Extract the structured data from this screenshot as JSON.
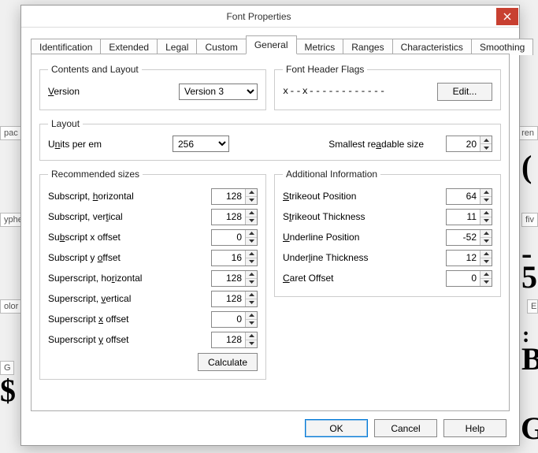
{
  "window": {
    "title": "Font Properties"
  },
  "tabs": {
    "identification": "Identification",
    "extended": "Extended",
    "legal": "Legal",
    "custom": "Custom",
    "general": "General",
    "metrics": "Metrics",
    "ranges": "Ranges",
    "characteristics": "Characteristics",
    "smoothing": "Smoothing"
  },
  "groups": {
    "contents": "Contents and Layout",
    "layout": "Layout",
    "recommended": "Recommended sizes",
    "flags": "Font Header Flags",
    "additional": "Additional Information"
  },
  "contents": {
    "version_label": "Version",
    "version_value": "Version 3"
  },
  "layout": {
    "units_label": "Units per em",
    "units_value": "256",
    "smallest_label": "Smallest readable size",
    "smallest_value": "20"
  },
  "recommended": {
    "sub_h_label": "Subscript, horizontal",
    "sub_h": "128",
    "sub_v_label": "Subscript, vertical",
    "sub_v": "128",
    "sub_x_label": "Subscript x offset",
    "sub_x": "0",
    "sub_y_label": "Subscript y offset",
    "sub_y": "16",
    "sup_h_label": "Superscript, horizontal",
    "sup_h": "128",
    "sup_v_label": "Superscript, vertical",
    "sup_v": "128",
    "sup_x_label": "Superscript x offset",
    "sup_x": "0",
    "sup_y_label": "Superscript y offset",
    "sup_y": "128",
    "calculate": "Calculate"
  },
  "flags": {
    "pattern": "x--x------------",
    "edit": "Edit..."
  },
  "additional": {
    "strike_pos_label": "Strikeout Position",
    "strike_pos": "64",
    "strike_thk_label": "Strikeout Thickness",
    "strike_thk": "11",
    "under_pos_label": "Underline Position",
    "under_pos": "-52",
    "under_thk_label": "Underline Thickness",
    "under_thk": "12",
    "caret_label": "Caret Offset",
    "caret": "0"
  },
  "buttons": {
    "ok": "OK",
    "cancel": "Cancel",
    "help": "Help"
  },
  "bg": {
    "pac": "pac",
    "yphe": "yphe",
    "olor": "olor",
    "g": "G",
    "ren": "ren",
    "fiv": "fiv",
    "e": "E"
  }
}
